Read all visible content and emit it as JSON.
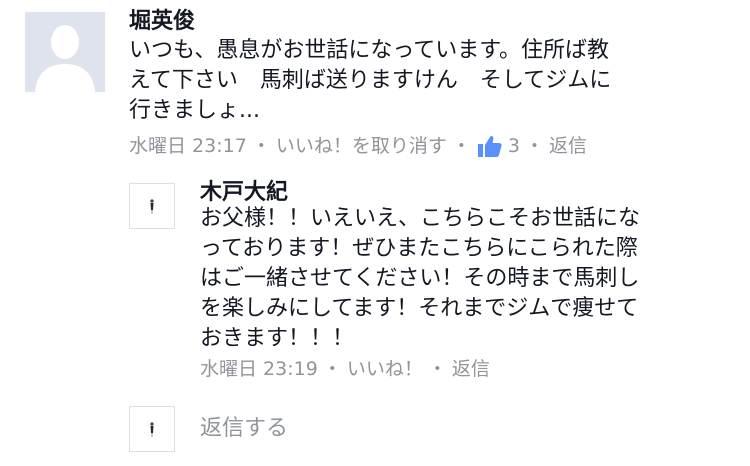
{
  "comment": {
    "author": "堀英俊",
    "text_line1": "いつも、愚息がお世話になっています。住所ば教",
    "text_line2": "えて下さい　馬刺ば送りますけん　そしてジムに",
    "text_line3": "行きましょ...",
    "time": "水曜日 23:17",
    "separator": "・",
    "unlike_label": "いいね！を取り消す",
    "like_count": "3",
    "reply_label": "返信",
    "colors": {
      "like_icon": "#5890ff"
    },
    "avatar_icon": "default-avatar-icon"
  },
  "reply": {
    "author": "木戸大紀",
    "text_line1": "お父様！！いえいえ、こちらこそお世話にな",
    "text_line2": "っております！ぜひまたこちらにこられた際",
    "text_line3": "はご一緒させてください！その時まで馬刺し",
    "text_line4": "を楽しみにしてます！それまでジムで痩せて",
    "text_line5": "おきます！！！",
    "time": "水曜日 23:19",
    "separator": "・",
    "like_label": "いいね！",
    "reply_label": "返信"
  },
  "composer": {
    "placeholder": "返信する"
  }
}
